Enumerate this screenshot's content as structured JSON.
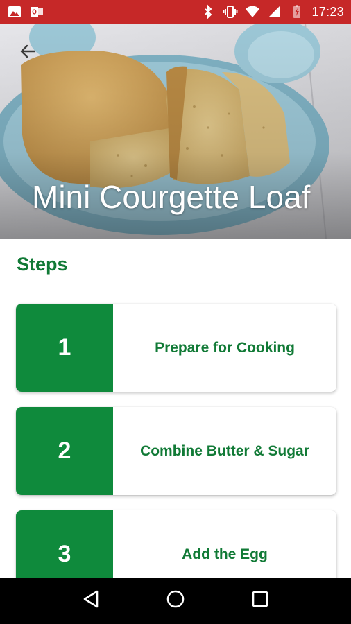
{
  "status_bar": {
    "time": "17:23",
    "left_icons": [
      "image-icon",
      "outlook-icon"
    ],
    "right_icons": [
      "bluetooth-icon",
      "vibrate-icon",
      "wifi-icon",
      "signal-icon",
      "battery-charging-icon"
    ],
    "color": "#c62828"
  },
  "hero": {
    "title": "Mini Courgette Loaf",
    "back_icon": "arrow-back-icon"
  },
  "steps": {
    "heading": "Steps",
    "items": [
      {
        "number": "1",
        "label": "Prepare for Cooking"
      },
      {
        "number": "2",
        "label": "Combine Butter & Sugar"
      },
      {
        "number": "3",
        "label": "Add the Egg"
      }
    ]
  },
  "nav_bar": {
    "icons": [
      "back-triangle-icon",
      "home-circle-icon",
      "recents-square-icon"
    ]
  },
  "colors": {
    "accent": "#0f8a3c",
    "accent_text": "#117a36",
    "status_bar": "#c62828"
  }
}
